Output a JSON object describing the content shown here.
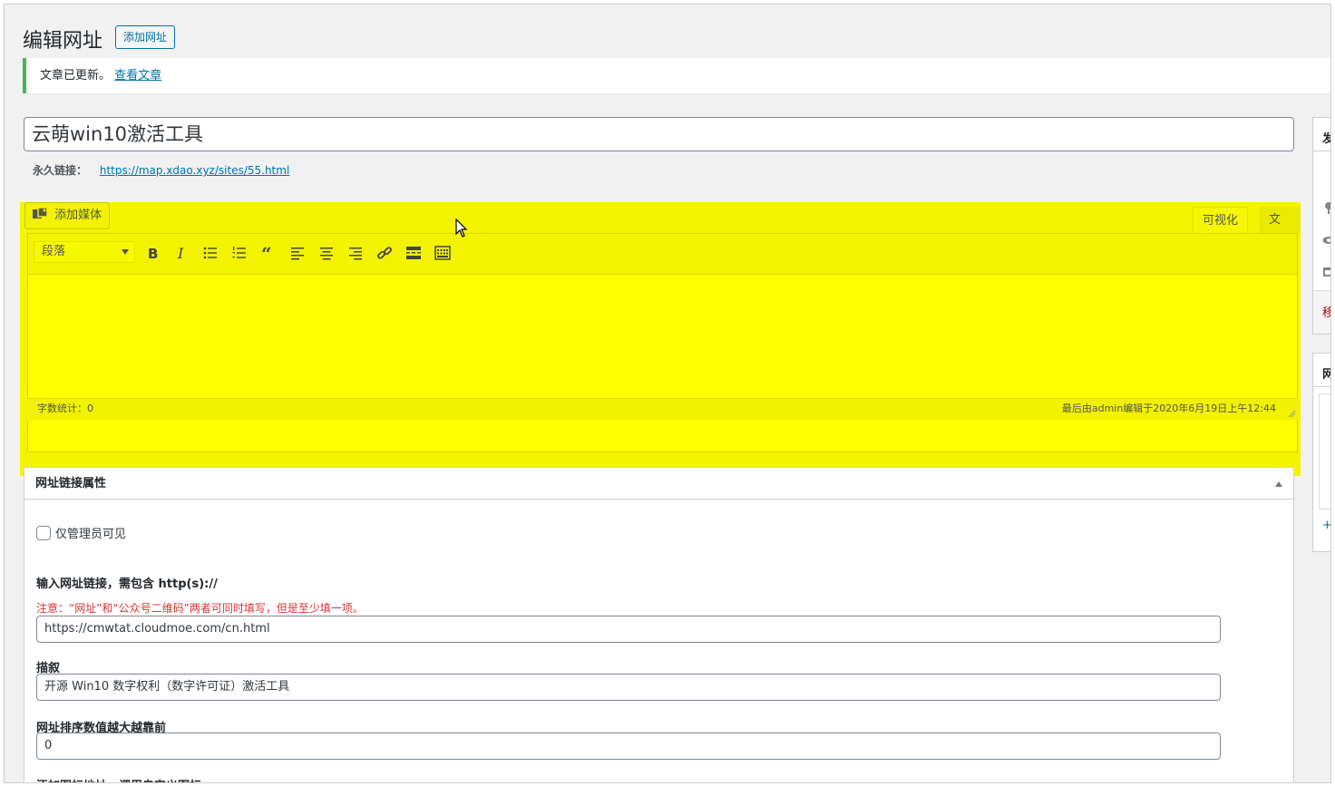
{
  "page": {
    "title": "编辑网址",
    "add_new": "添加网址"
  },
  "notice": {
    "text": "文章已更新。",
    "link": "查看文章"
  },
  "post": {
    "title": "云萌win10激活工具",
    "permalink_label": "永久链接：",
    "permalink_url": "https://map.xdao.xyz/sites/55.html"
  },
  "editor": {
    "add_media": "添加媒体",
    "tabs": [
      "可视化",
      "文本"
    ],
    "format": "段落",
    "toolbar_icons": [
      "bold-icon",
      "italic-icon",
      "bullet-list-icon",
      "numbered-list-icon",
      "blockquote-icon",
      "align-left-icon",
      "align-center-icon",
      "align-right-icon",
      "link-icon",
      "read-more-icon",
      "toolbar-toggle-icon"
    ],
    "word_count": "字数统计：0",
    "last_edited": "最后由admin编辑于2020年6月19日上午12:44",
    "highlight_color": "#ffff00"
  },
  "metabox": {
    "title": "网址链接属性",
    "admin_only_label": "仅管理员可见",
    "url_label": "输入网址链接，需包含 http(s)://",
    "url_warning": "注意：“网址”和“公众号二维码”两者可同时填写，但是至少填一项。",
    "url_value": "https://cmwtat.cloudmoe.com/cn.html",
    "desc_label": "描叙",
    "desc_value": "开源 Win10 数字权利（数字许可证）激活工具",
    "order_label": "网址排序数值越大越靠前",
    "order_value": "0",
    "partial_label": "添加图标地址，调用自定义图标"
  },
  "sidebar": {
    "publish_initial": "发",
    "trash_initial": "移",
    "category_initial": "网",
    "add_link": "+"
  }
}
